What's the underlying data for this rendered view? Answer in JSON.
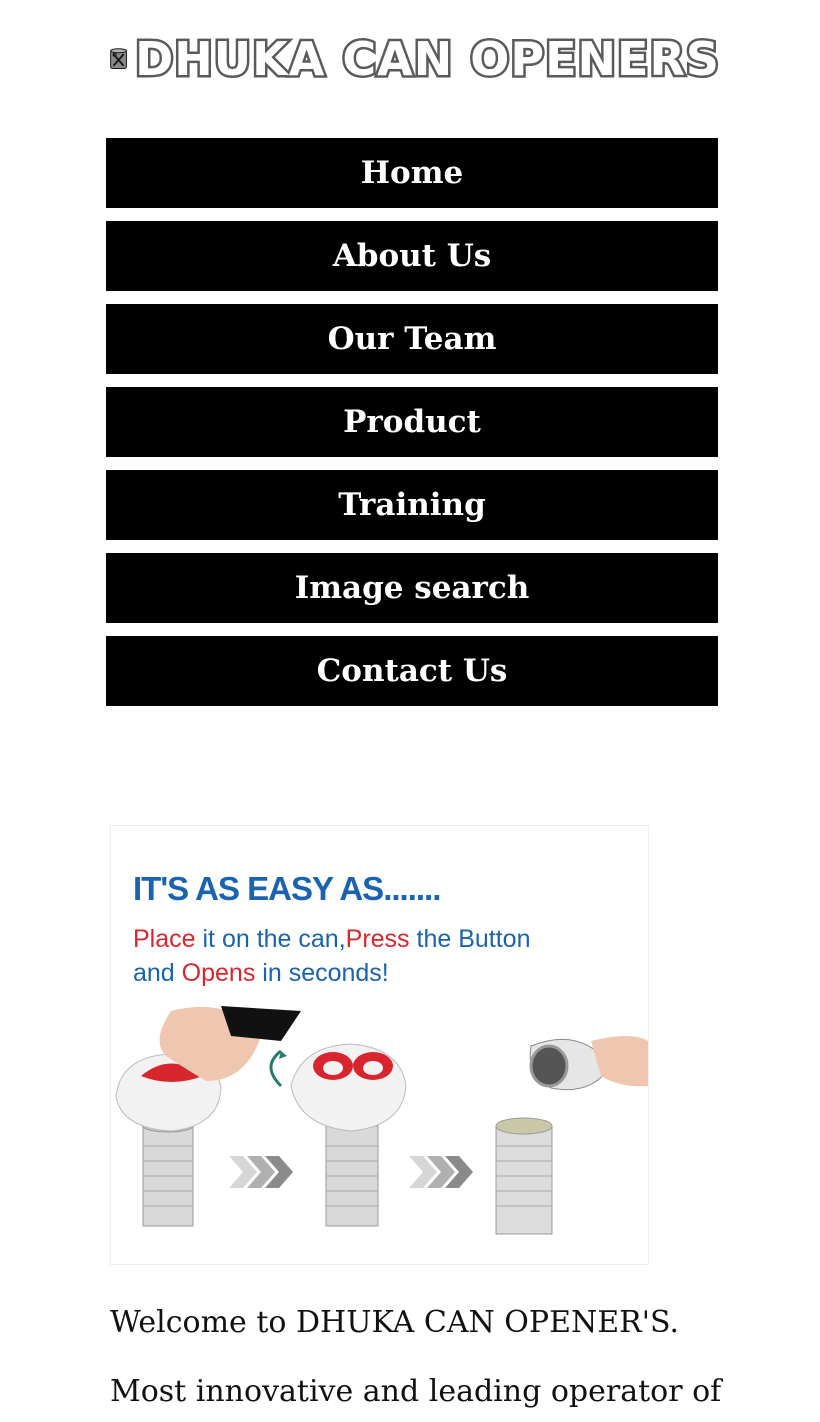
{
  "site": {
    "brand": "DHUKA CAN OPENERS",
    "logo_icon": "can-opener-icon"
  },
  "nav": {
    "items": [
      {
        "label": "Home"
      },
      {
        "label": "About Us"
      },
      {
        "label": "Our Team"
      },
      {
        "label": "Product"
      },
      {
        "label": "Training"
      },
      {
        "label": "Image search"
      },
      {
        "label": "Contact Us"
      }
    ]
  },
  "promo": {
    "headline": "IT'S AS EASY AS.......",
    "line1_parts": [
      "Place",
      " it on the can,",
      "Press",
      " the Button"
    ],
    "line2_parts": [
      "and ",
      "Opens",
      " in seconds!"
    ],
    "colors": {
      "blue": "#1a63b0",
      "red": "#d9262e"
    }
  },
  "content": {
    "welcome": "Welcome to DHUKA CAN OPENER'S.",
    "intro": "Most innovative and leading operator of"
  }
}
